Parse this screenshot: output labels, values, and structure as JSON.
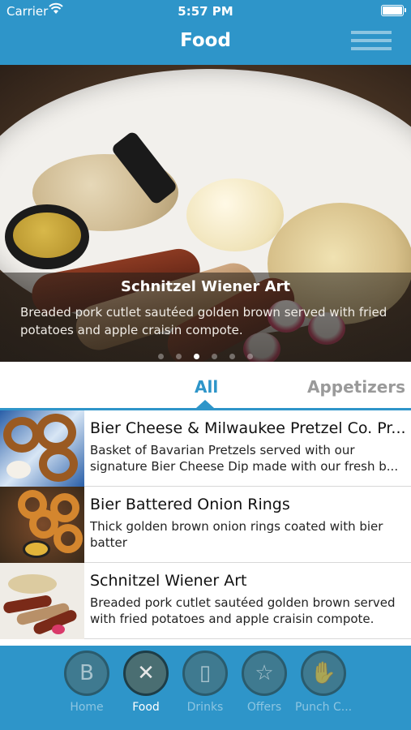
{
  "status_bar": {
    "carrier": "Carrier",
    "time": "5:57 PM"
  },
  "header": {
    "title": "Food",
    "menu_icon": "hamburger-menu-icon"
  },
  "hero": {
    "title": "Schnitzel Wiener Art",
    "description": "Breaded pork cutlet sautéed golden brown served with fried potatoes and apple craisin compote.",
    "slide_count": 6,
    "active_slide": 3
  },
  "tabs": [
    {
      "label": "All",
      "selected": true
    },
    {
      "label": "Appetizers",
      "selected": false
    }
  ],
  "menu_items": [
    {
      "title": "Bier Cheese & Milwaukee Pretzel Co. Pr...",
      "description": "Basket of Bavarian Pretzels served with our signature Bier Cheese Dip made with our fresh b..."
    },
    {
      "title": "Bier Battered Onion Rings",
      "description": "Thick golden brown onion rings coated with bier batter"
    },
    {
      "title": "Schnitzel Wiener Art",
      "description": "Breaded pork cutlet sautéed golden brown served with fried potatoes and apple craisin compote."
    }
  ],
  "bottom_nav": [
    {
      "label": "Home",
      "icon": "bavarian-logo-icon",
      "glyph": "B",
      "active": false
    },
    {
      "label": "Food",
      "icon": "fork-knife-icon",
      "glyph": "✕",
      "active": true
    },
    {
      "label": "Drinks",
      "icon": "beer-mug-icon",
      "glyph": "▯",
      "active": false
    },
    {
      "label": "Offers",
      "icon": "star-icon",
      "glyph": "☆",
      "active": false
    },
    {
      "label": "Punch C...",
      "icon": "handshake-icon",
      "glyph": "✋",
      "active": false
    }
  ],
  "colors": {
    "brand_blue": "#2e95c9",
    "tab_inactive": "#9a9a9a"
  }
}
